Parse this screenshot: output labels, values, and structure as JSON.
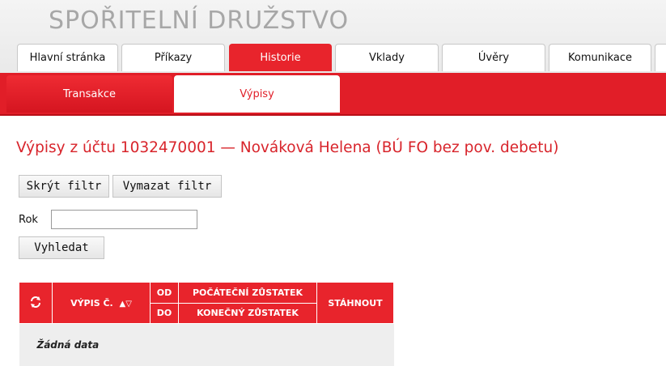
{
  "logo_text": "SPOŘITELNÍ DRUŽSTVO",
  "main_tabs": [
    {
      "label": "Hlavní stránka"
    },
    {
      "label": "Příkazy"
    },
    {
      "label": "Historie"
    },
    {
      "label": "Vklady"
    },
    {
      "label": "Úvěry"
    },
    {
      "label": "Komunikace"
    }
  ],
  "sub_tabs": [
    {
      "label": "Transakce"
    },
    {
      "label": "Výpisy"
    }
  ],
  "page_title": "Výpisy z účtu 1032470001 — Nováková Helena (BÚ FO bez pov. debetu)",
  "filter": {
    "hide_label": "Skrýt filtr",
    "clear_label": "Vymazat filtr",
    "year_label": "Rok",
    "year_value": "",
    "search_label": "Vyhledat"
  },
  "table": {
    "col_number": "VÝPIS Č.",
    "col_from": "OD",
    "col_to": "DO",
    "col_start_balance": "POČÁTEČNÍ ZŮSTATEK",
    "col_end_balance": "KONEČNÝ ZŮSTATEK",
    "col_download": "STÁHNOUT",
    "empty_text": "Žádná data"
  },
  "colors": {
    "accent": "#e11e28",
    "logo": "#a7a7a7"
  }
}
